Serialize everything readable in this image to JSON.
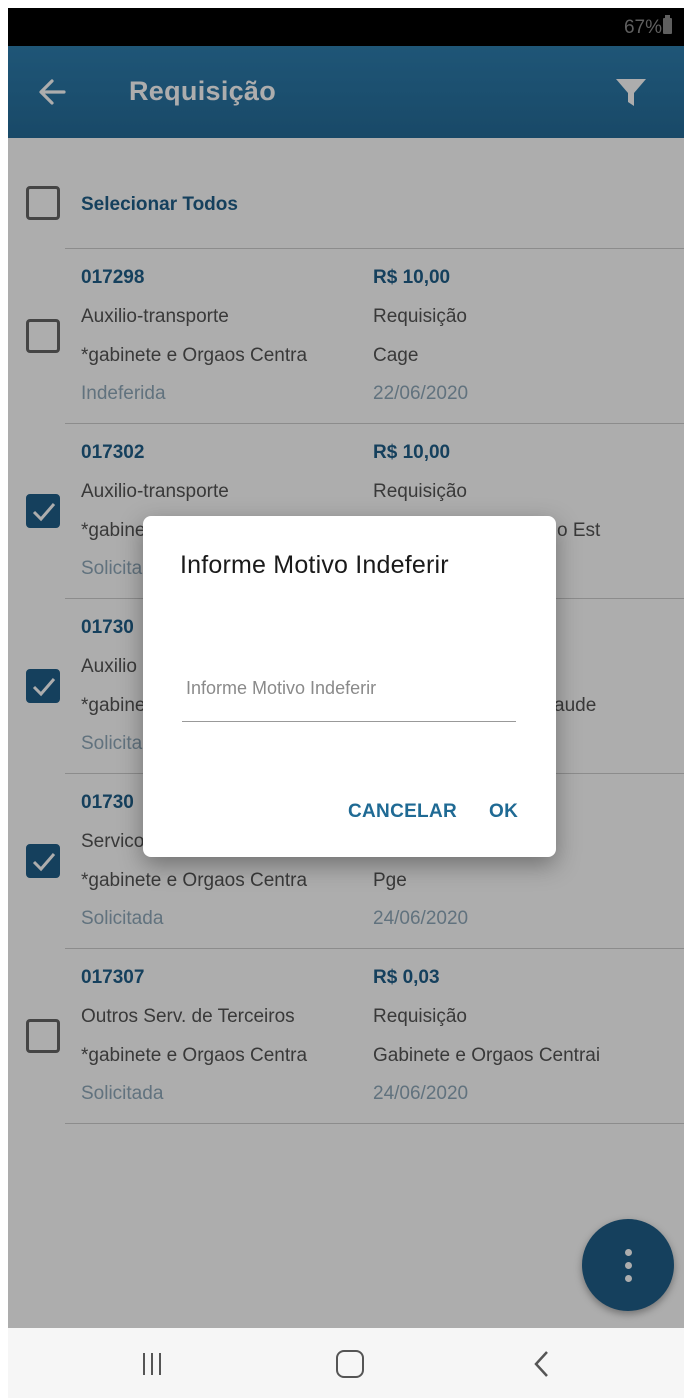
{
  "status_bar": {
    "battery": "67%"
  },
  "app_bar": {
    "title": "Requisição"
  },
  "select_all": {
    "label": "Selecionar Todos",
    "checked": false
  },
  "items": [
    {
      "code": "017298",
      "value": "R$ 10,00",
      "type": "Auxilio-transporte",
      "kind": "Requisição",
      "origin": "*gabinete e Orgaos Centra",
      "destination": "Cage",
      "status": "Indeferida",
      "date": "22/06/2020",
      "checked": false
    },
    {
      "code": "017302",
      "value": "R$ 10,00",
      "type": "Auxilio-transporte",
      "kind": "Requisição",
      "origin": "*gabine",
      "destination": "o Est",
      "status": "Solicita",
      "date": "",
      "checked": true
    },
    {
      "code": "01730",
      "value": "",
      "type": "Auxilio",
      "kind": "",
      "origin": "*gabine",
      "destination": "aude",
      "status": "Solicita",
      "date": "",
      "checked": true
    },
    {
      "code": "01730",
      "value": "",
      "type": "Servico",
      "kind": "",
      "origin": "*gabinete e Orgaos Centra",
      "destination": "Pge",
      "status": "Solicitada",
      "date": "24/06/2020",
      "checked": true
    },
    {
      "code": "017307",
      "value": "R$ 0,03",
      "type": "Outros Serv. de Terceiros",
      "kind": "Requisição",
      "origin": "*gabinete e Orgaos Centra",
      "destination": "Gabinete e Orgaos Centrai",
      "status": "Solicitada",
      "date": "24/06/2020",
      "checked": false
    }
  ],
  "dialog": {
    "title": "Informe Motivo Indeferir",
    "input_placeholder": "Informe Motivo Indeferir",
    "input_value": "",
    "cancel_label": "CANCELAR",
    "ok_label": "OK"
  },
  "colors": {
    "primary": "#1f5f8a",
    "appbar": "#2a76a6",
    "muted": "#8fa9ba"
  },
  "icons": {
    "back": "arrow-left-icon",
    "filter": "filter-icon",
    "fab": "more-vertical-icon"
  }
}
